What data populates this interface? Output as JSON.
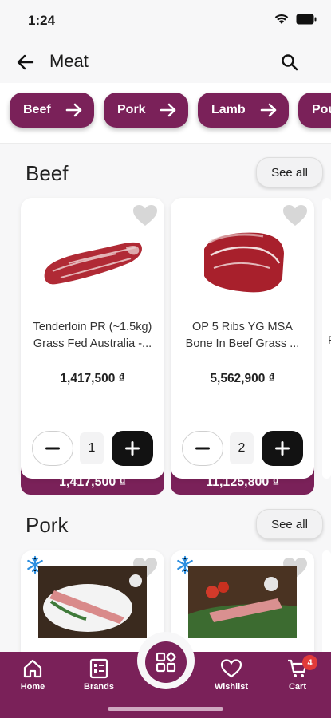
{
  "status": {
    "time": "1:24"
  },
  "header": {
    "title": "Meat"
  },
  "categories": [
    {
      "label": "Beef"
    },
    {
      "label": "Pork"
    },
    {
      "label": "Lamb"
    },
    {
      "label": "Pou"
    }
  ],
  "sections": [
    {
      "title": "Beef",
      "see_all": "See all",
      "products": [
        {
          "name_line1": "Tenderloin PR (~1.5kg)",
          "name_line2": "Grass Fed Australia -...",
          "price": "1,417,500 ₫",
          "quantity": "1",
          "total": "1,417,500 ₫"
        },
        {
          "name_line1": "OP 5 Ribs YG MSA",
          "name_line2": "Bone In Beef Grass ...",
          "price": "5,562,900 ₫",
          "quantity": "2",
          "total": "11,125,800 ₫"
        }
      ],
      "peek_text": "R"
    },
    {
      "title": "Pork",
      "see_all": "See all"
    }
  ],
  "bottom_nav": {
    "home": "Home",
    "brands": "Brands",
    "wishlist": "Wishlist",
    "cart": "Cart",
    "cart_count": "4"
  },
  "colors": {
    "brand": "#7a2159",
    "plus_button": "#121212",
    "badge": "#e23a3a"
  }
}
